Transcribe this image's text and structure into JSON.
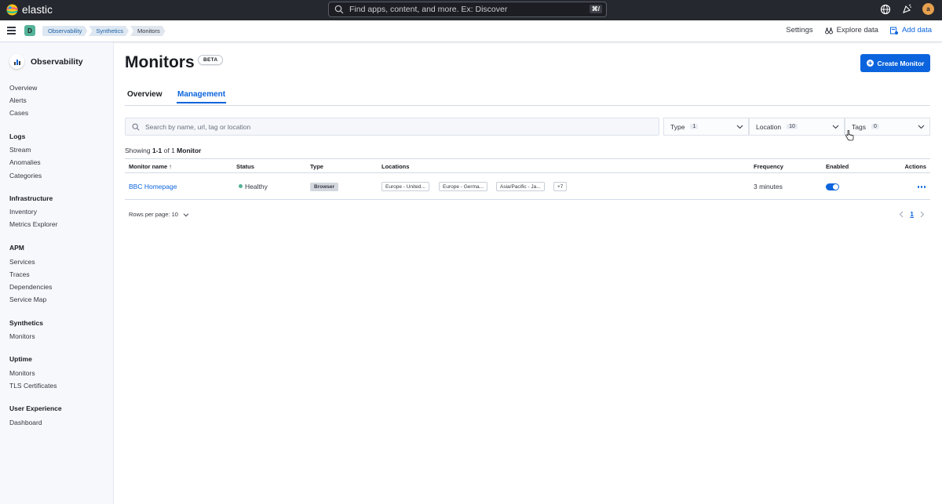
{
  "header": {
    "logo_text": "elastic",
    "search_placeholder": "Find apps, content, and more. Ex: Discover",
    "search_shortcut": "⌘/",
    "avatar_initial": "a"
  },
  "subbar": {
    "space_initial": "D",
    "breadcrumbs": [
      "Observability",
      "Synthetics",
      "Monitors"
    ],
    "settings_label": "Settings",
    "explore_label": "Explore data",
    "add_data_label": "Add data"
  },
  "sidebar": {
    "title": "Observability",
    "top_items": [
      "Overview",
      "Alerts",
      "Cases"
    ],
    "groups": [
      {
        "title": "Logs",
        "items": [
          "Stream",
          "Anomalies",
          "Categories"
        ]
      },
      {
        "title": "Infrastructure",
        "items": [
          "Inventory",
          "Metrics Explorer"
        ]
      },
      {
        "title": "APM",
        "items": [
          "Services",
          "Traces",
          "Dependencies",
          "Service Map"
        ]
      },
      {
        "title": "Synthetics",
        "items": [
          "Monitors"
        ]
      },
      {
        "title": "Uptime",
        "items": [
          "Monitors",
          "TLS Certificates"
        ]
      },
      {
        "title": "User Experience",
        "items": [
          "Dashboard"
        ]
      }
    ]
  },
  "page": {
    "title": "Monitors",
    "beta_badge": "BETA",
    "create_button": "Create Monitor",
    "tabs": [
      "Overview",
      "Management"
    ],
    "active_tab": "Management"
  },
  "filters": {
    "search_placeholder": "Search by name, url, tag or location",
    "type_label": "Type",
    "type_count": "1",
    "location_label": "Location",
    "location_count": "10",
    "tags_label": "Tags",
    "tags_count": "0"
  },
  "summary": {
    "prefix": "Showing ",
    "range": "1-1",
    "middle": " of 1 ",
    "noun": "Monitor"
  },
  "table": {
    "columns": [
      "Monitor name",
      "Status",
      "Type",
      "Locations",
      "Frequency",
      "Enabled",
      "Actions"
    ],
    "sort_indicator": "↑",
    "rows": [
      {
        "name": "BBC Homepage",
        "status": "Healthy",
        "type": "Browser",
        "locations": [
          "Europe - United...",
          "Europe - Germa...",
          "Asia/Pacific - Ja..."
        ],
        "more_locations": "+7",
        "frequency": "3 minutes",
        "enabled": true
      }
    ]
  },
  "pagination": {
    "rows_per_page": "Rows per page: 10",
    "current_page": "1"
  },
  "colors": {
    "primary": "#0b64dd",
    "healthy": "#54b399",
    "header_bg": "#25282f"
  }
}
